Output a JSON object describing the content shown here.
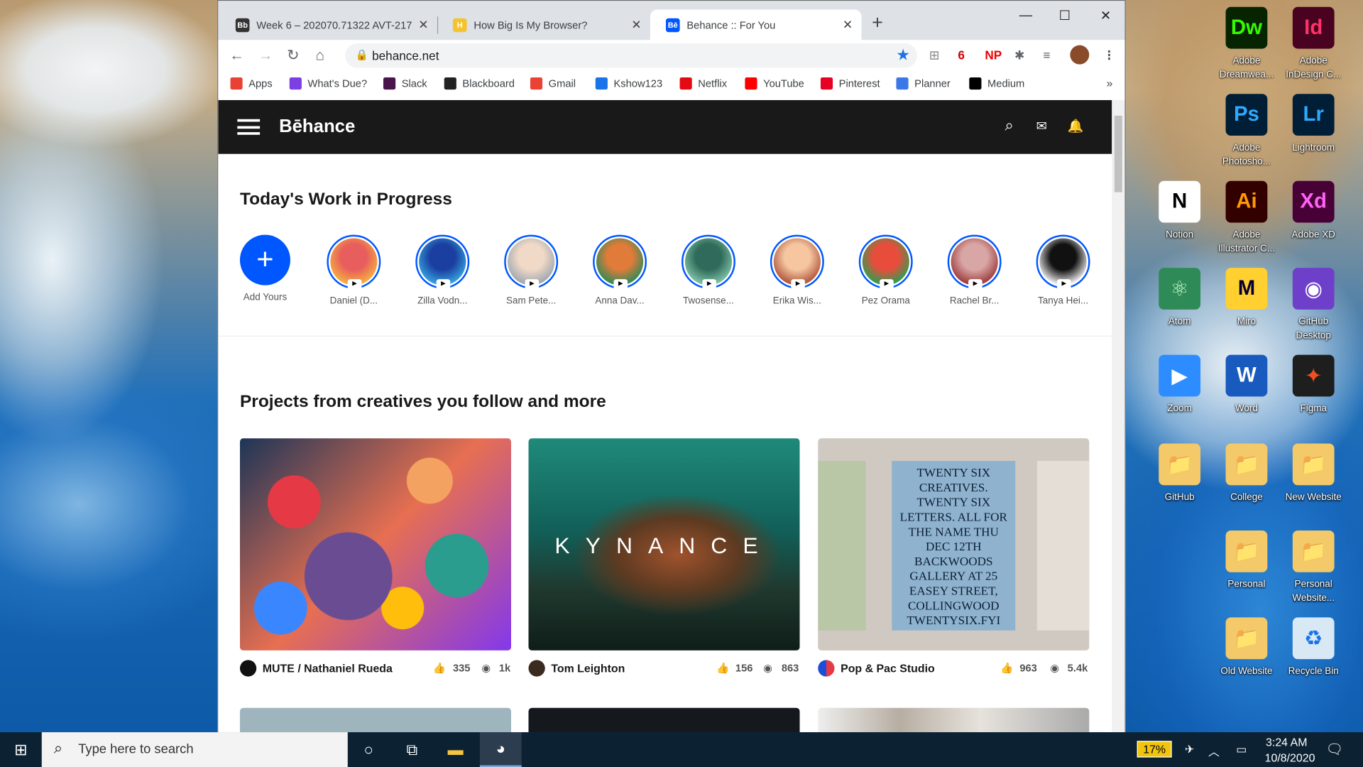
{
  "browser": {
    "tabs": [
      {
        "label": "Week 6 – 202070.71322 AVT-217",
        "fav": "Bb",
        "color": "#333"
      },
      {
        "label": "How Big Is My Browser?",
        "fav": "H",
        "color": "#f4c430"
      },
      {
        "label": "Behance :: For You",
        "fav": "Bē",
        "color": "#0057ff"
      }
    ],
    "url": "behance.net",
    "extensions": [
      {
        "t": "6",
        "c": "#c00"
      },
      {
        "t": "NP",
        "c": "#e00"
      }
    ],
    "bookmarks": [
      {
        "label": "Apps",
        "c": "#e94235"
      },
      {
        "label": "What's Due?",
        "c": "#7b3fe4"
      },
      {
        "label": "Slack",
        "c": "#4a154b"
      },
      {
        "label": "Blackboard",
        "c": "#222"
      },
      {
        "label": "Gmail",
        "c": "#ea4335"
      },
      {
        "label": "Kshow123",
        "c": "#1a73e8"
      },
      {
        "label": "Netflix",
        "c": "#e50914"
      },
      {
        "label": "YouTube",
        "c": "#ff0000"
      },
      {
        "label": "Pinterest",
        "c": "#e60023"
      },
      {
        "label": "Planner",
        "c": "#3b78e7"
      },
      {
        "label": "Medium",
        "c": "#000"
      }
    ]
  },
  "behance": {
    "logo": "Bēhance",
    "wip_title": "Today's Work in Progress",
    "stories": [
      {
        "name": "Add Yours",
        "add": true
      },
      {
        "name": "Daniel (D...",
        "c1": "#e85d5d",
        "c2": "#f5b041"
      },
      {
        "name": "Zilla Vodn...",
        "c1": "#1b3fa0",
        "c2": "#36a3e0"
      },
      {
        "name": "Sam Pete...",
        "c1": "#f0d9c6",
        "c2": "#9fa7b0"
      },
      {
        "name": "Anna Dav...",
        "c1": "#e07b39",
        "c2": "#2e8b57"
      },
      {
        "name": "Twosense...",
        "c1": "#2f6a5a",
        "c2": "#7fc3a5"
      },
      {
        "name": "Erika Wis...",
        "c1": "#f5c6a0",
        "c2": "#b0553a"
      },
      {
        "name": "Pez Orama",
        "c1": "#e84d3c",
        "c2": "#2e9e4f"
      },
      {
        "name": "Rachel Br...",
        "c1": "#d9a6a6",
        "c2": "#9c3b3b"
      },
      {
        "name": "Tanya Hei...",
        "c1": "#111",
        "c2": "#eee"
      }
    ],
    "projects_title": "Projects from creatives you follow and more",
    "projects": [
      {
        "owner": "MUTE / Nathaniel Rueda",
        "likes": "335",
        "views": "1k"
      },
      {
        "owner": "Tom Leighton",
        "likes": "156",
        "views": "863",
        "overlay": "KYNANCE"
      },
      {
        "owner": "Pop & Pac Studio",
        "likes": "963",
        "views": "5.4k",
        "poster": "TWENTY SIX CREATIVES. TWENTY SIX LETTERS. ALL FOR THE NAME THU DEC 12TH BACKWOODS GALLERY AT 25 EASEY STREET, COLLINGWOOD TWENTYSIX.FYI"
      }
    ]
  },
  "desktop": [
    {
      "label": "Adobe Dreamwea...",
      "glyph": "Dw",
      "bg": "#072401",
      "fg": "#35fa00"
    },
    {
      "label": "Adobe InDesign C...",
      "glyph": "Id",
      "bg": "#49021f",
      "fg": "#ff3366"
    },
    {
      "label": "Adobe Photosho...",
      "glyph": "Ps",
      "bg": "#001e36",
      "fg": "#31a8ff"
    },
    {
      "label": "Lightroom",
      "glyph": "Lr",
      "bg": "#001e36",
      "fg": "#31a8ff"
    },
    {
      "label": "Notion",
      "glyph": "N",
      "bg": "#fff",
      "fg": "#000"
    },
    {
      "label": "Adobe Illustrator C...",
      "glyph": "Ai",
      "bg": "#330000",
      "fg": "#ff9a00"
    },
    {
      "label": "Adobe XD",
      "glyph": "Xd",
      "bg": "#470137",
      "fg": "#ff61f6"
    },
    {
      "label": "Atom",
      "glyph": "⚛",
      "bg": "#2e8b57",
      "fg": "#c8f7c5"
    },
    {
      "label": "Miro",
      "glyph": "M",
      "bg": "#ffd02f",
      "fg": "#050038"
    },
    {
      "label": "GitHub Desktop",
      "glyph": "◉",
      "bg": "#6e40c9",
      "fg": "#fff"
    },
    {
      "label": "Zoom",
      "glyph": "▶",
      "bg": "#2d8cff",
      "fg": "#fff"
    },
    {
      "label": "Word",
      "glyph": "W",
      "bg": "#185abd",
      "fg": "#fff"
    },
    {
      "label": "Figma",
      "glyph": "✦",
      "bg": "#1e1e1e",
      "fg": "#f24e1e"
    },
    {
      "label": "GitHub",
      "glyph": "📁",
      "bg": "#f3c969",
      "fg": "#000"
    },
    {
      "label": "College",
      "glyph": "📁",
      "bg": "#f3c969",
      "fg": "#000"
    },
    {
      "label": "New Website",
      "glyph": "📁",
      "bg": "#f3c969",
      "fg": "#000"
    },
    {
      "label": "Personal",
      "glyph": "📁",
      "bg": "#f3c969",
      "fg": "#000"
    },
    {
      "label": "Personal Website...",
      "glyph": "📁",
      "bg": "#f3c969",
      "fg": "#000"
    },
    {
      "label": "Old Website",
      "glyph": "📁",
      "bg": "#f3c969",
      "fg": "#000"
    },
    {
      "label": "Recycle Bin",
      "glyph": "♻",
      "bg": "#d9e8f5",
      "fg": "#1a73e8"
    }
  ],
  "taskbar": {
    "search_placeholder": "Type here to search",
    "battery": "17%",
    "time": "3:24 AM",
    "date": "10/8/2020"
  }
}
